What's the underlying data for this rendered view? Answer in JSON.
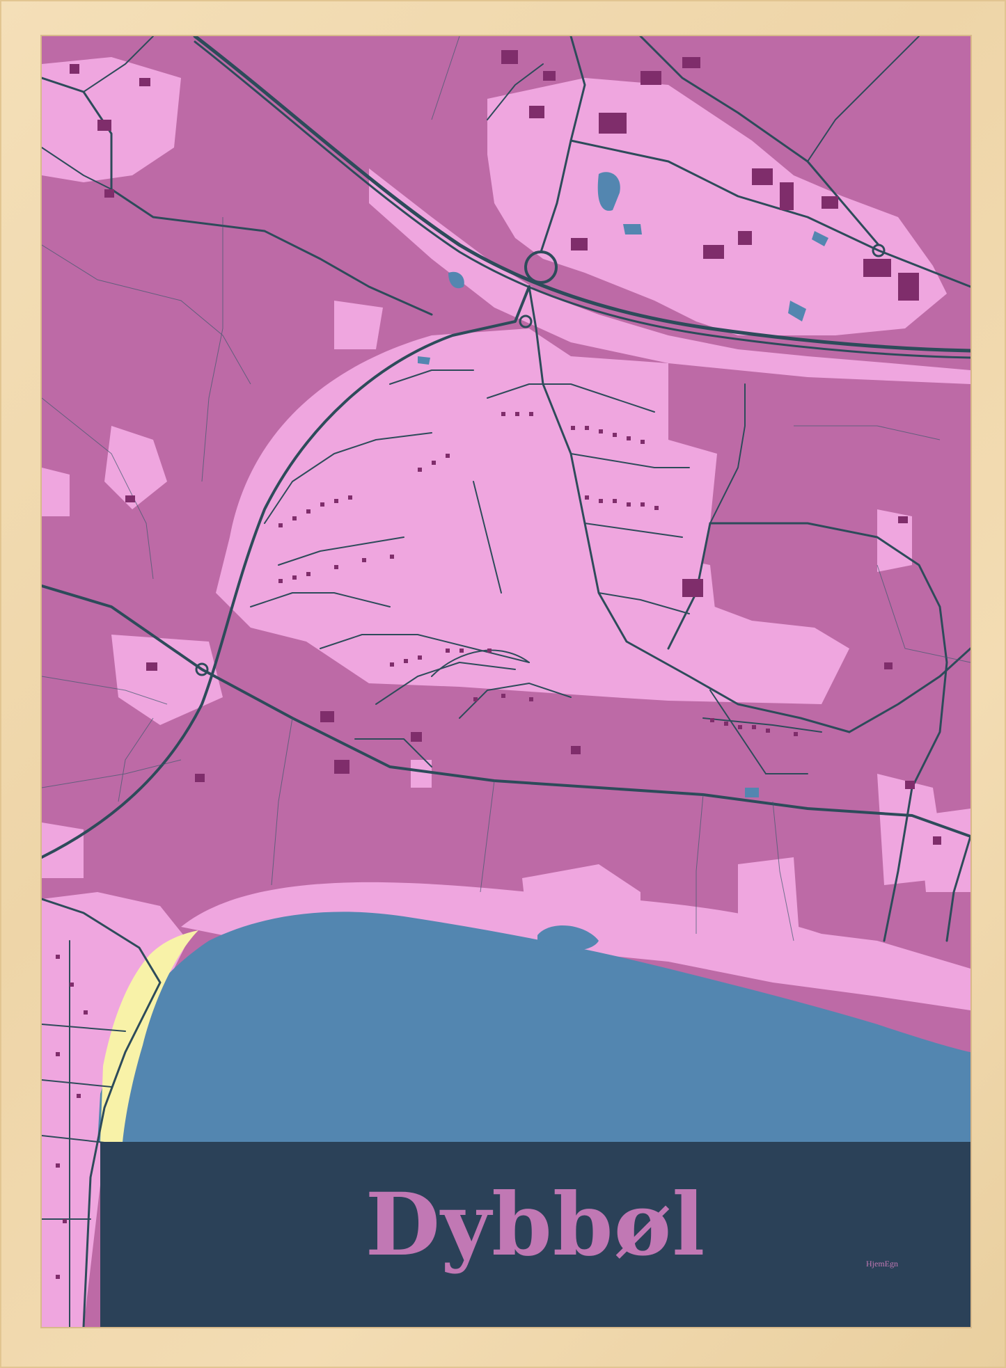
{
  "poster": {
    "title": "Dybbøl",
    "brand": "HjemEgn"
  },
  "colors": {
    "land": "#bd6aa6",
    "urban": "#efa6df",
    "buildings": "#7f2d6b",
    "roads": "#2d4b5a",
    "water": "#5386b0",
    "beach": "#f8f2a8",
    "band": "#2b4158",
    "frame": "#f1dab0"
  }
}
